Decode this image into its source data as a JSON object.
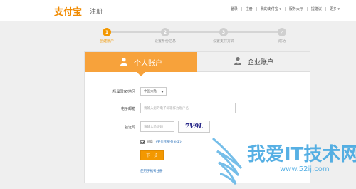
{
  "header": {
    "logo": "支付宝",
    "title": "注册",
    "nav": [
      "登录",
      "注册",
      "我的支付宝",
      "服务大厅",
      "提建议",
      "更多"
    ]
  },
  "steps": [
    {
      "num": "1",
      "label": "创建账户"
    },
    {
      "num": "2",
      "label": "设置身份信息"
    },
    {
      "num": "3",
      "label": "设置支付方式"
    },
    {
      "num": "✓",
      "label": "成功"
    }
  ],
  "tabs": {
    "personal": "个人账户",
    "business": "企业账户"
  },
  "form": {
    "country_label": "所属国家/地区",
    "country_value": "中国大陆",
    "email_label": "电子邮箱",
    "email_placeholder": "请输入您的电子邮箱作为账户名",
    "captcha_label": "验证码",
    "captcha_placeholder": "请输入验证码",
    "captcha_text": "7V9L",
    "agree_prefix": "同意",
    "agree_link": "《支付宝服务协议》",
    "next_label": "下一步",
    "mobile_link": "使用手机号注册"
  },
  "watermark": {
    "text": "我爱IT技术网",
    "url": "www.52ij.com"
  },
  "colors": {
    "accent": "#f39800",
    "tab_active": "#f7a23b",
    "link": "#2a6fb8",
    "watermark": "#3aa3e0"
  }
}
